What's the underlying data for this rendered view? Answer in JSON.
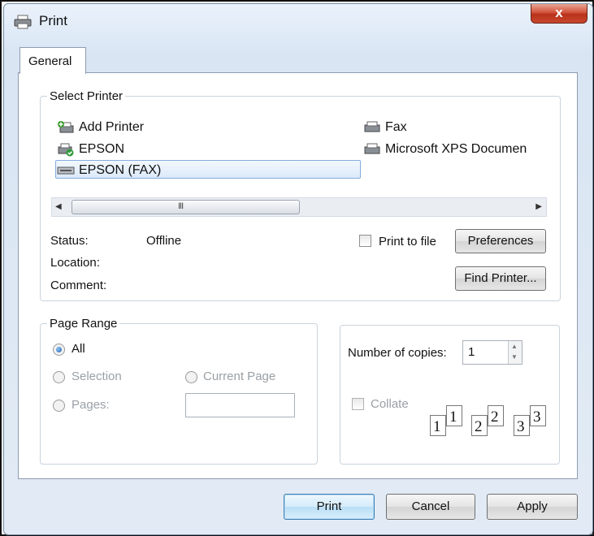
{
  "window": {
    "title": "Print",
    "close_label": "x"
  },
  "tabs": [
    {
      "label": "General"
    }
  ],
  "select_printer": {
    "legend": "Select Printer",
    "printers": [
      {
        "name": "Add Printer",
        "icon": "add-printer-icon"
      },
      {
        "name": "EPSON",
        "icon": "default-printer-icon"
      },
      {
        "name": "EPSON  (FAX)",
        "icon": "fax-printer-icon",
        "selected": true
      },
      {
        "name": "Fax",
        "icon": "printer-icon"
      },
      {
        "name": "Microsoft XPS Documen",
        "icon": "printer-icon"
      }
    ],
    "scrollbar_grip": "III",
    "status_label": "Status:",
    "status_value": "Offline",
    "location_label": "Location:",
    "comment_label": "Comment:",
    "print_to_file_label": "Print to file",
    "print_to_file_checked": false,
    "preferences_label": "Preferences",
    "find_printer_label": "Find Printer..."
  },
  "page_range": {
    "legend": "Page Range",
    "all_label": "All",
    "selection_label": "Selection",
    "current_page_label": "Current Page",
    "pages_label": "Pages:",
    "selected": "All",
    "pages_value": ""
  },
  "copies": {
    "number_label": "Number of copies:",
    "value": "1",
    "collate_label": "Collate",
    "collate_checked": false,
    "collate_pages": [
      "1",
      "1",
      "2",
      "2",
      "3",
      "3"
    ]
  },
  "buttons": {
    "print": "Print",
    "cancel": "Cancel",
    "apply": "Apply"
  }
}
